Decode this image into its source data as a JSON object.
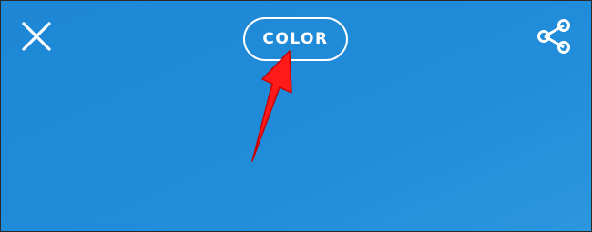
{
  "toolbar": {
    "close_icon": "close-icon",
    "mode_label": "COLOR",
    "share_icon": "share-icon"
  },
  "annotation": {
    "arrow_color": "#ff1a1a"
  },
  "colors": {
    "background": "#1f8ad8",
    "foreground": "#ffffff"
  }
}
